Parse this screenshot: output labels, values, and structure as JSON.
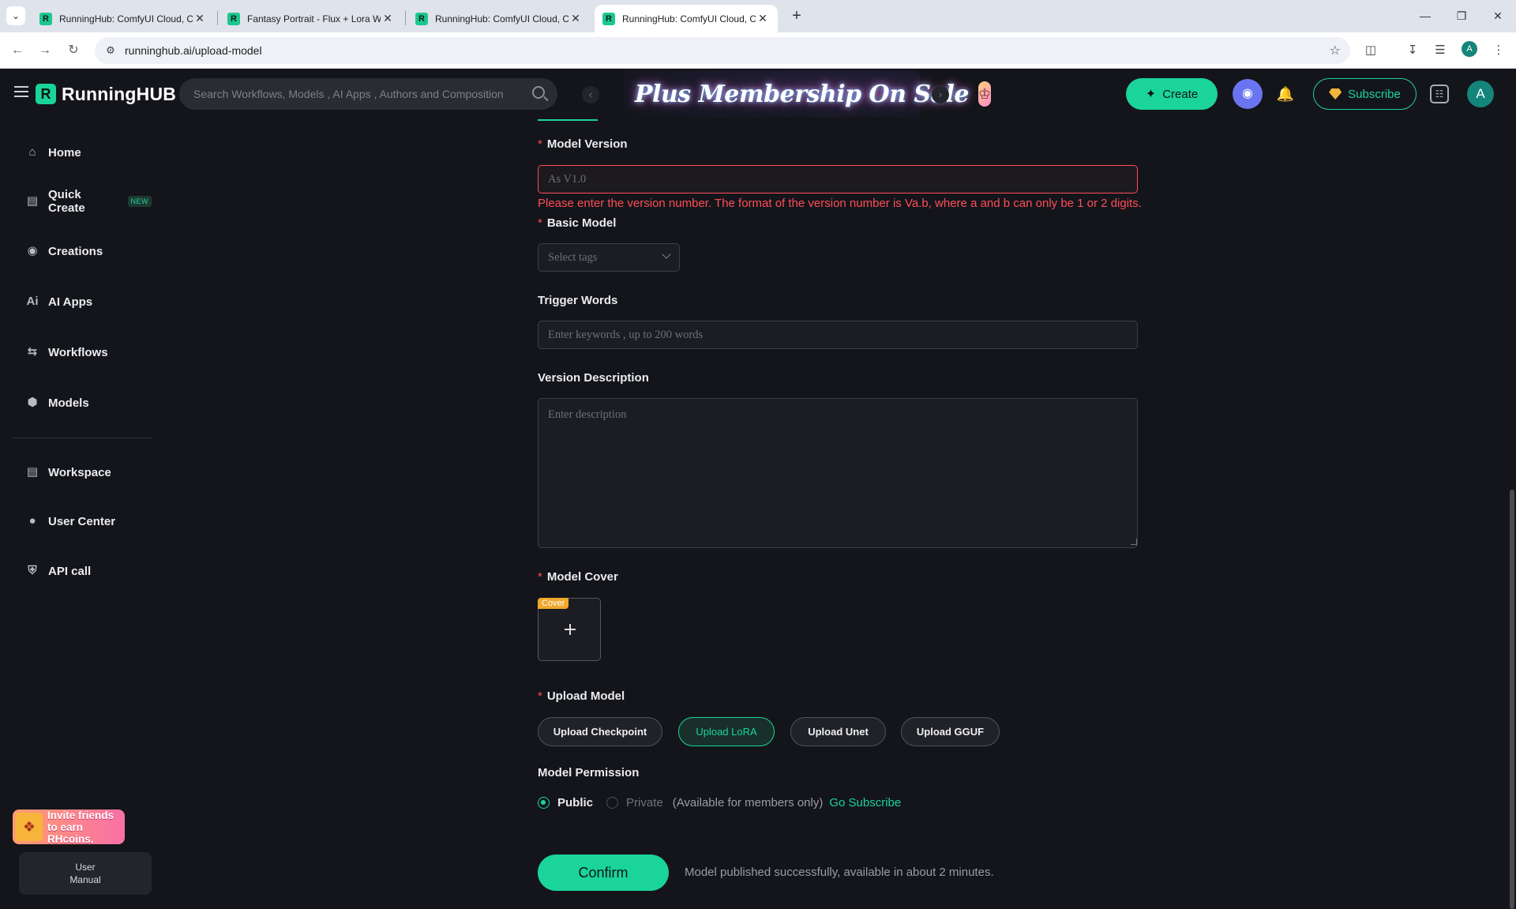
{
  "browser": {
    "tabs": [
      {
        "title": "RunningHub: ComfyUI Cloud, C",
        "active": false
      },
      {
        "title": "Fantasy Portrait - Flux + Lora W",
        "active": false
      },
      {
        "title": "RunningHub: ComfyUI Cloud, C",
        "active": false
      },
      {
        "title": "RunningHub: ComfyUI Cloud, C",
        "active": true
      }
    ],
    "favicon_letter": "R",
    "url": "runninghub.ai/upload-model",
    "profile_initial": "A"
  },
  "header": {
    "logo_letter": "R",
    "logo_text": "RunningHUB",
    "search_placeholder": "Search Workflows, Models , AI Apps , Authors and Composition",
    "promo_text": "Plus Membership On Sale",
    "create_label": "Create",
    "subscribe_label": "Subscribe",
    "avatar_initial": "A"
  },
  "sidebar": {
    "items": [
      {
        "label": "Home",
        "icon": "home-icon"
      },
      {
        "label": "Quick Create",
        "icon": "quick-create-icon",
        "badge": "NEW"
      },
      {
        "label": "Creations",
        "icon": "creations-icon"
      },
      {
        "label": "AI Apps",
        "icon": "ai-apps-icon"
      },
      {
        "label": "Workflows",
        "icon": "workflows-icon"
      },
      {
        "label": "Models",
        "icon": "models-icon"
      },
      {
        "label": "Workspace",
        "icon": "workspace-icon"
      },
      {
        "label": "User Center",
        "icon": "user-icon"
      },
      {
        "label": "API call",
        "icon": "api-icon"
      }
    ],
    "invite_line1": "Invite friends",
    "invite_line2": "to earn RHcoins.",
    "manual_line1": "User",
    "manual_line2": "Manual"
  },
  "form": {
    "model_version": {
      "label": "Model Version",
      "placeholder": "As V1.0",
      "value": "",
      "error": "Please enter the version number. The format of the version number is Va.b, where a and b can only be 1 or 2 digits."
    },
    "basic_model": {
      "label": "Basic Model",
      "placeholder": "Select tags"
    },
    "trigger_words": {
      "label": "Trigger Words",
      "placeholder": "Enter keywords , up to 200 words"
    },
    "version_description": {
      "label": "Version Description",
      "placeholder": "Enter description"
    },
    "model_cover": {
      "label": "Model Cover",
      "tag": "Cover"
    },
    "upload_model": {
      "label": "Upload Model",
      "options": [
        "Upload Checkpoint",
        "Upload LoRA",
        "Upload Unet",
        "Upload GGUF"
      ],
      "selected": "Upload LoRA"
    },
    "permission": {
      "label": "Model Permission",
      "public_label": "Public",
      "private_label": "Private",
      "members_note": "(Available for members only)",
      "subscribe_link": "Go Subscribe",
      "selected": "Public"
    },
    "confirm_label": "Confirm",
    "confirm_note": "Model published successfully, available in about 2 minutes."
  },
  "colors": {
    "accent": "#1bd49a",
    "error": "#ff4d57",
    "background": "#13151a",
    "cover_tag": "#f0a82c"
  }
}
